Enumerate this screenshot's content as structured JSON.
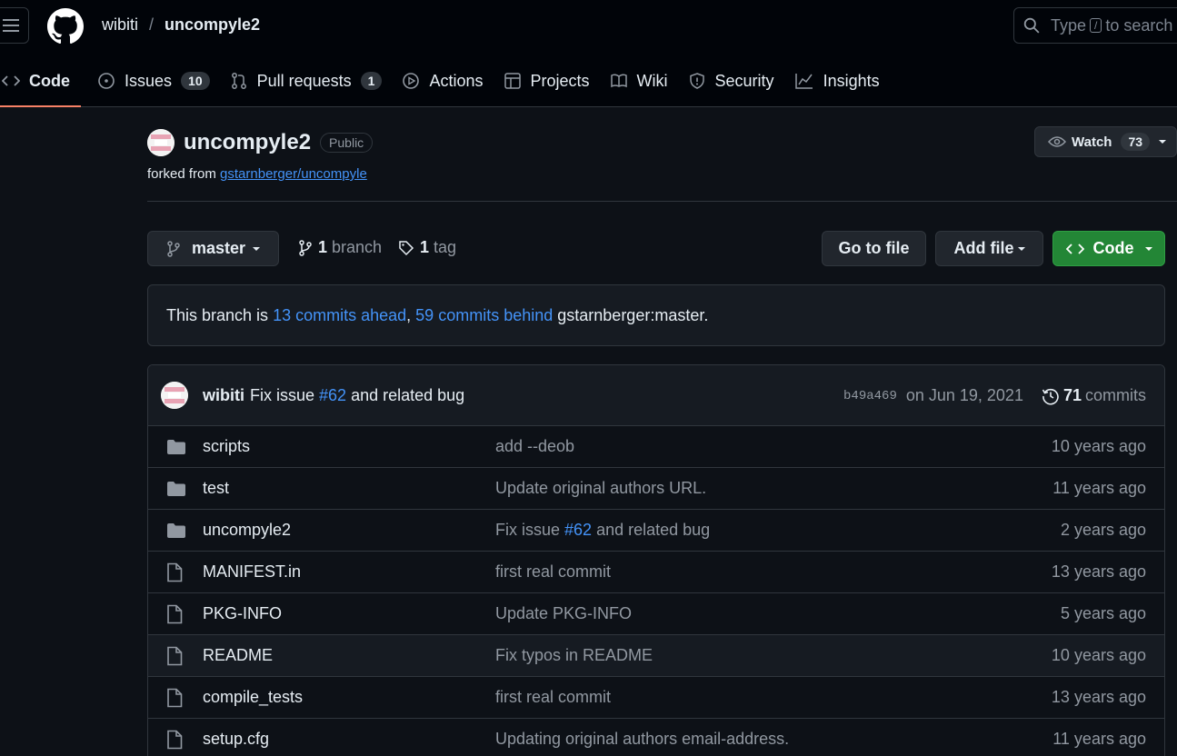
{
  "header": {
    "owner": "wibiti",
    "separator": "/",
    "repo": "uncompyle2",
    "search_prefix": "Type",
    "search_key": "/",
    "search_suffix": "to search"
  },
  "tabs": [
    {
      "label": "Code",
      "icon": "code-icon",
      "count": ""
    },
    {
      "label": "Issues",
      "icon": "issue-icon",
      "count": "10"
    },
    {
      "label": "Pull requests",
      "icon": "pull-request-icon",
      "count": "1"
    },
    {
      "label": "Actions",
      "icon": "play-icon",
      "count": ""
    },
    {
      "label": "Projects",
      "icon": "table-icon",
      "count": ""
    },
    {
      "label": "Wiki",
      "icon": "book-icon",
      "count": ""
    },
    {
      "label": "Security",
      "icon": "shield-icon",
      "count": ""
    },
    {
      "label": "Insights",
      "icon": "graph-icon",
      "count": ""
    }
  ],
  "repo": {
    "name": "uncompyle2",
    "visibility": "Public",
    "forked_prefix": "forked from",
    "forked_source": "gstarnberger/uncompyle",
    "watch_label": "Watch",
    "watch_count": "73"
  },
  "branch_bar": {
    "branch": "master",
    "branch_count": "1",
    "branch_label": "branch",
    "tag_count": "1",
    "tag_label": "tag",
    "goto_label": "Go to file",
    "add_label": "Add file",
    "code_label": "Code"
  },
  "notice": {
    "prefix": "This branch is",
    "ahead": "13 commits ahead",
    "comma": ",",
    "behind": "59 commits behind",
    "suffix": "gstarnberger:master."
  },
  "latest_commit": {
    "author": "wibiti",
    "message_prefix": "Fix issue",
    "issue_ref": "#62",
    "message_suffix": "and related bug",
    "sha": "b49a469",
    "date": "on Jun 19, 2021",
    "commit_count": "71",
    "commits_label": "commits"
  },
  "files": [
    {
      "name": "scripts",
      "type": "folder",
      "msg": "add --deob",
      "ref": "",
      "msg_suffix": "",
      "age": "10 years ago"
    },
    {
      "name": "test",
      "type": "folder",
      "msg": "Update original authors URL.",
      "ref": "",
      "msg_suffix": "",
      "age": "11 years ago"
    },
    {
      "name": "uncompyle2",
      "type": "folder",
      "msg": "Fix issue",
      "ref": "#62",
      "msg_suffix": "and related bug",
      "age": "2 years ago"
    },
    {
      "name": "MANIFEST.in",
      "type": "file",
      "msg": "first real commit",
      "ref": "",
      "msg_suffix": "",
      "age": "13 years ago"
    },
    {
      "name": "PKG-INFO",
      "type": "file",
      "msg": "Update PKG-INFO",
      "ref": "",
      "msg_suffix": "",
      "age": "5 years ago"
    },
    {
      "name": "README",
      "type": "file",
      "msg": "Fix typos in README",
      "ref": "",
      "msg_suffix": "",
      "age": "10 years ago"
    },
    {
      "name": "compile_tests",
      "type": "file",
      "msg": "first real commit",
      "ref": "",
      "msg_suffix": "",
      "age": "13 years ago"
    },
    {
      "name": "setup.cfg",
      "type": "file",
      "msg": "Updating original authors email-address.",
      "ref": "",
      "msg_suffix": "",
      "age": "11 years ago"
    }
  ],
  "colors": {
    "background": "#0d1117",
    "header": "#010409",
    "link": "#4493f8",
    "primary_button": "#238636",
    "active_tab_underline": "#f78166"
  }
}
